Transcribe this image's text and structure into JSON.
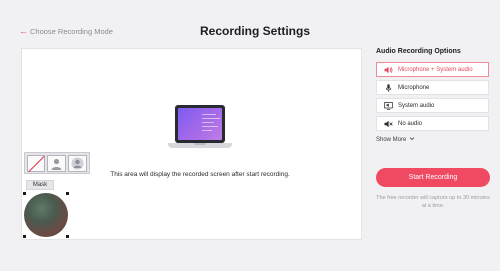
{
  "header": {
    "back_label": "Choose Recording Mode",
    "title": "Recording Settings"
  },
  "preview": {
    "message": "This area will display the recorded screen after start recording."
  },
  "mask": {
    "label": "Mask",
    "options": [
      "no-mask-icon",
      "person-silhouette-icon",
      "avatar-icon"
    ]
  },
  "audio": {
    "title": "Audio Recording Options",
    "options": [
      {
        "label": "Microphone + System audio",
        "icon": "speaker-icon",
        "selected": true
      },
      {
        "label": "Microphone",
        "icon": "microphone-icon",
        "selected": false
      },
      {
        "label": "System audio",
        "icon": "monitor-speaker-icon",
        "selected": false
      },
      {
        "label": "No audio",
        "icon": "mute-icon",
        "selected": false
      }
    ],
    "show_more": "Show More"
  },
  "start_button": "Start Recording",
  "note": "The free recorder will capture up to 30 minutes at a time.",
  "colors": {
    "accent": "#f04a63",
    "background": "#f1f1f4"
  }
}
